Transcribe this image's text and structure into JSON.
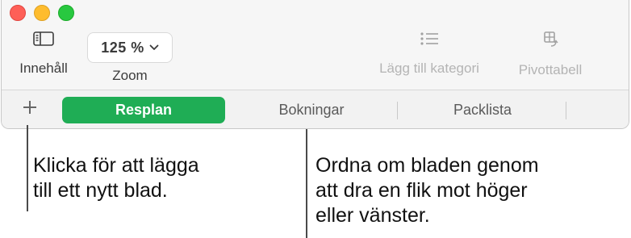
{
  "toolbar": {
    "contents_label": "Innehåll",
    "zoom_value": "125 %",
    "zoom_label": "Zoom",
    "add_category_label": "Lägg till kategori",
    "pivot_label": "Pivottabell"
  },
  "tabs": [
    {
      "label": "Resplan",
      "active": true
    },
    {
      "label": "Bokningar",
      "active": false
    },
    {
      "label": "Packlista",
      "active": false
    }
  ],
  "add_tab_symbol": "+",
  "callouts": {
    "add_sheet": [
      "Klicka för att lägga",
      "till ett nytt blad."
    ],
    "reorder": [
      "Ordna om bladen genom",
      "att dra en flik mot höger",
      "eller vänster."
    ]
  },
  "colors": {
    "active_tab": "#1fad55",
    "close": "#fe5f57",
    "minimize": "#febc2e",
    "zoom": "#28c840"
  },
  "icons": [
    "sidebar-icon",
    "chevron-down-icon",
    "list-icon",
    "pivot-table-icon",
    "plus-icon"
  ]
}
